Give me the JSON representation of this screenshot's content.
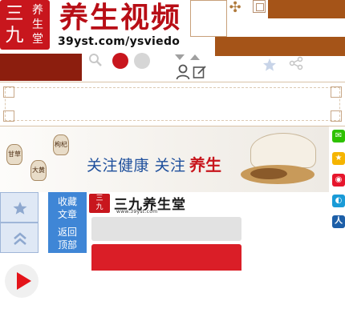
{
  "header": {
    "seal_big": "三九",
    "seal_small": "养生堂",
    "site_title": "养生视频",
    "site_url": "39yst.com/ysviedo"
  },
  "toolbar": {
    "icons": [
      "search-icon",
      "red-dot",
      "gray-dot",
      "user-icon",
      "edit-icon",
      "star-icon",
      "share-icon"
    ]
  },
  "banner": {
    "sacks": [
      "甘草",
      "大黄",
      "枸杞"
    ],
    "slogan": "关注健康 关注",
    "slogan_brand": "养生"
  },
  "social": [
    "wechat",
    "qzone",
    "weibo",
    "tencent-weibo",
    "renren"
  ],
  "float_panel": {
    "favorite": "收藏文章",
    "back_top": "返回顶部"
  },
  "brand": {
    "seal": "三九",
    "name": "三九养生堂",
    "url": "www.39yst.com"
  },
  "colors": {
    "brand_red": "#c8161d",
    "wood": "#a55418",
    "panel_blue": "#3f86d6",
    "slogan_blue": "#1e4f9c"
  }
}
